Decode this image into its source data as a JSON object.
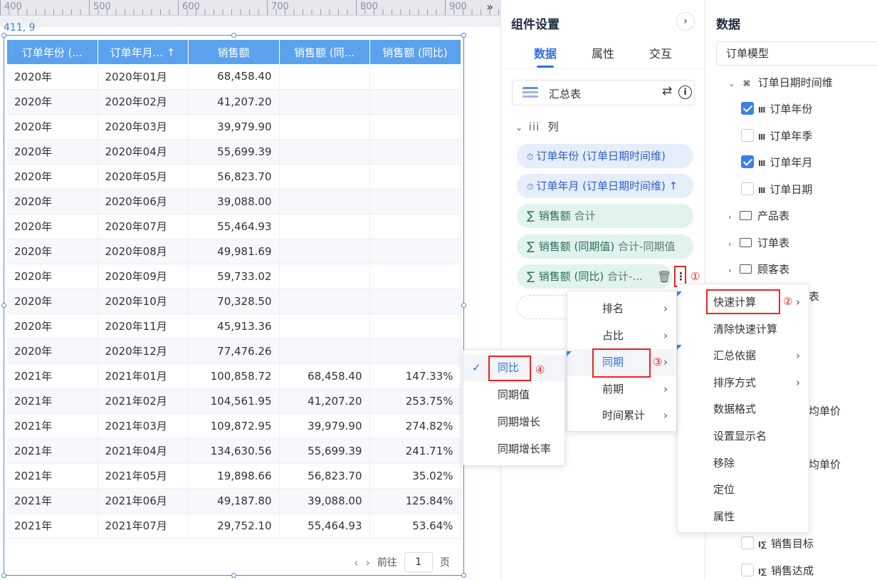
{
  "ruler": {
    "ticks": [
      "400",
      "500",
      "600",
      "700",
      "800",
      "900"
    ],
    "collapse_icon": "double-chevron-right-icon"
  },
  "canvas": {
    "coord": "411, 9"
  },
  "table": {
    "headers": [
      "订单年份 (...",
      "订单年月... ↑",
      "销售额",
      "销售额 (同...",
      "销售额 (同比)"
    ],
    "rows": [
      [
        "2020年",
        "2020年01月",
        "68,458.40",
        "",
        ""
      ],
      [
        "2020年",
        "2020年02月",
        "41,207.20",
        "",
        ""
      ],
      [
        "2020年",
        "2020年03月",
        "39,979.90",
        "",
        ""
      ],
      [
        "2020年",
        "2020年04月",
        "55,699.39",
        "",
        ""
      ],
      [
        "2020年",
        "2020年05月",
        "56,823.70",
        "",
        ""
      ],
      [
        "2020年",
        "2020年06月",
        "39,088.00",
        "",
        ""
      ],
      [
        "2020年",
        "2020年07月",
        "55,464.93",
        "",
        ""
      ],
      [
        "2020年",
        "2020年08月",
        "49,981.69",
        "",
        ""
      ],
      [
        "2020年",
        "2020年09月",
        "59,733.02",
        "",
        ""
      ],
      [
        "2020年",
        "2020年10月",
        "70,328.50",
        "",
        ""
      ],
      [
        "2020年",
        "2020年11月",
        "45,913.36",
        "",
        ""
      ],
      [
        "2020年",
        "2020年12月",
        "77,476.26",
        "",
        ""
      ],
      [
        "2021年",
        "2021年01月",
        "100,858.72",
        "68,458.40",
        "147.33%"
      ],
      [
        "2021年",
        "2021年02月",
        "104,561.95",
        "41,207.20",
        "253.75%"
      ],
      [
        "2021年",
        "2021年03月",
        "109,872.95",
        "39,979.90",
        "274.82%"
      ],
      [
        "2021年",
        "2021年04月",
        "134,630.56",
        "55,699.39",
        "241.71%"
      ],
      [
        "2021年",
        "2021年05月",
        "19,898.66",
        "56,823.70",
        "35.02%"
      ],
      [
        "2021年",
        "2021年06月",
        "49,187.80",
        "39,088.00",
        "125.84%"
      ],
      [
        "2021年",
        "2021年07月",
        "29,752.10",
        "55,464.93",
        "53.64%"
      ]
    ]
  },
  "pager": {
    "prev": "‹",
    "next": "›",
    "goto_label": "前往",
    "page_value": "1",
    "page_unit": "页"
  },
  "settings": {
    "title": "组件设置",
    "collapse": "›",
    "tabs": [
      "数据",
      "属性",
      "交互"
    ],
    "chart_type": "汇总表",
    "section_label": "列",
    "columns": [
      {
        "kind": "dim",
        "label": "订单年份 (订单日期时间维)",
        "suffix": ""
      },
      {
        "kind": "dim",
        "label": "订单年月 (订单日期时间维)",
        "suffix": "↑"
      },
      {
        "kind": "meas",
        "label": "销售额",
        "sub": "合计"
      },
      {
        "kind": "meas",
        "label": "销售额 (同期值)",
        "sub": "合计-同期值"
      },
      {
        "kind": "meas",
        "label": "销售额 (同比)",
        "sub": "合计-..."
      }
    ],
    "more_label": "⋮",
    "marks": [
      "①",
      "②",
      "③",
      "④"
    ]
  },
  "menu_main": [
    "快速计算",
    "清除快速计算",
    "汇总依据",
    "排序方式",
    "数据格式",
    "设置显示名",
    "移除",
    "定位",
    "属性"
  ],
  "menu_main_submenu": [
    true,
    false,
    true,
    true,
    false,
    false,
    false,
    false,
    false
  ],
  "menu_quick": [
    "排名",
    "占比",
    "同期",
    "前期",
    "时间累计"
  ],
  "menu_period": [
    "同比",
    "同期值",
    "同期增长",
    "同期增长率"
  ],
  "menu_period_checked": "✓",
  "data_panel": {
    "title": "数据",
    "model": "订单模型",
    "time_dim": "订单日期时间维",
    "time_fields": [
      {
        "label": "订单年份",
        "checked": true
      },
      {
        "label": "订单年季",
        "checked": false
      },
      {
        "label": "订单年月",
        "checked": true
      },
      {
        "label": "订单日期",
        "checked": false
      }
    ],
    "folders": [
      "产品表",
      "订单表",
      "顾客表"
    ],
    "partial": [
      "表",
      "均单价",
      "均单价"
    ],
    "measures": [
      {
        "label": "销售目标",
        "checked": false
      },
      {
        "label": "销售达成",
        "checked": false
      }
    ]
  }
}
